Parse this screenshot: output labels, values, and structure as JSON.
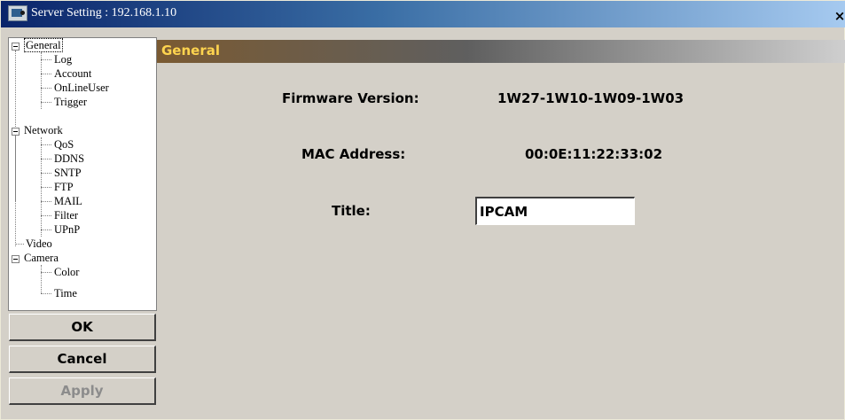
{
  "window": {
    "title": "Server Setting : 192.168.1.10",
    "close_label": "×"
  },
  "tree": {
    "items": [
      {
        "label": "General",
        "level": 0,
        "expanded": true,
        "selected": true
      },
      {
        "label": "Log",
        "level": 1
      },
      {
        "label": "Account",
        "level": 1
      },
      {
        "label": "OnLineUser",
        "level": 1
      },
      {
        "label": "Trigger",
        "level": 1
      },
      {
        "label": "Network",
        "level": 0,
        "expanded": true
      },
      {
        "label": "QoS",
        "level": 1
      },
      {
        "label": "DDNS",
        "level": 1
      },
      {
        "label": "SNTP",
        "level": 1
      },
      {
        "label": "FTP",
        "level": 1
      },
      {
        "label": "MAIL",
        "level": 1
      },
      {
        "label": "Filter",
        "level": 1
      },
      {
        "label": "UPnP",
        "level": 1
      },
      {
        "label": "Video",
        "level": 0
      },
      {
        "label": "Camera",
        "level": 0,
        "expanded": true
      },
      {
        "label": "Color",
        "level": 1
      },
      {
        "label": "Time",
        "level": 1
      }
    ]
  },
  "buttons": {
    "ok": "OK",
    "cancel": "Cancel",
    "apply": "Apply"
  },
  "panel": {
    "header": "General",
    "firmware_label": "Firmware Version:",
    "firmware_value": "1W27-1W10-1W09-1W03",
    "mac_label": "MAC Address:",
    "mac_value": "00:0E:11:22:33:02",
    "title_label": "Title:",
    "title_value": "IPCAM"
  },
  "colors": {
    "panel_header_text": "#ffd44f",
    "window_bg": "#d4d0c8",
    "titlebar_start": "#0a246a"
  }
}
